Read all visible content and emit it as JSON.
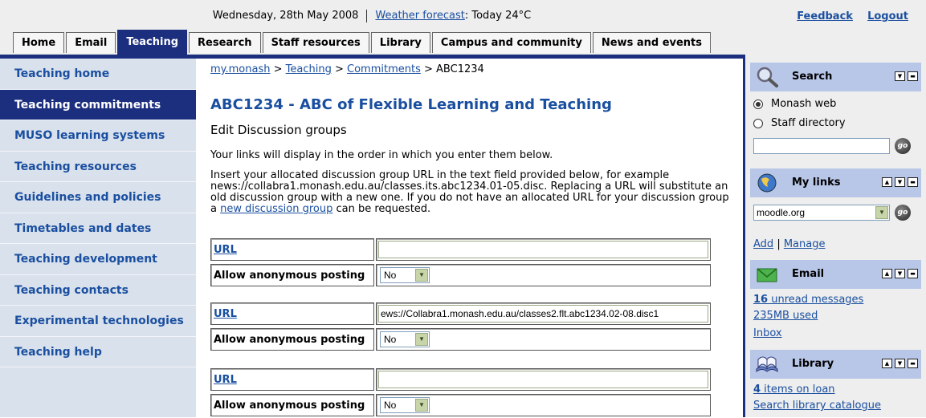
{
  "header": {
    "date": "Wednesday, 28th May 2008",
    "weather_link": "Weather forecast",
    "weather_text": ": Today 24°C",
    "feedback": "Feedback",
    "logout": "Logout"
  },
  "tabs": [
    {
      "label": "Home"
    },
    {
      "label": "Email"
    },
    {
      "label": "Teaching",
      "active": true
    },
    {
      "label": "Research"
    },
    {
      "label": "Staff resources"
    },
    {
      "label": "Library"
    },
    {
      "label": "Campus and community"
    },
    {
      "label": "News and events"
    }
  ],
  "nav": {
    "items": [
      {
        "label": "Teaching home"
      },
      {
        "label": "Teaching commitments",
        "active": true
      },
      {
        "label": "MUSO learning systems"
      },
      {
        "label": "Teaching resources"
      },
      {
        "label": "Guidelines and policies"
      },
      {
        "label": "Timetables and dates"
      },
      {
        "label": "Teaching development"
      },
      {
        "label": "Teaching contacts"
      },
      {
        "label": "Experimental technologies"
      },
      {
        "label": "Teaching help"
      }
    ]
  },
  "breadcrumb": {
    "crumb1": "my.monash",
    "sep": " > ",
    "crumb2": "Teaching",
    "crumb3": "Commitments",
    "current": "ABC1234"
  },
  "main": {
    "title": "ABC1234 - ABC of Flexible Learning and Teaching",
    "subtitle": "Edit Discussion groups",
    "intro": "Your links will display in the order in which you enter them below.",
    "instructions_before": "Insert your allocated discussion group URL in the text field provided below, for example news://collabra1.monash.edu.au/classes.its.abc1234.01-05.disc. Replacing a URL will substitute an old discussion group with a new one. If you do not have an allocated URL for your discussion group a ",
    "instructions_link": "new discussion group",
    "instructions_after": " can be requested.",
    "url_label": "URL",
    "anon_label": "Allow anonymous posting",
    "groups": [
      {
        "url": "",
        "anon": "No"
      },
      {
        "url": "ews://Collabra1.monash.edu.au/classes2.flt.abc1234.02-08.disc1",
        "anon": "No"
      },
      {
        "url": "",
        "anon": "No"
      }
    ]
  },
  "right": {
    "search": {
      "title": "Search",
      "option1": "Monash web",
      "option2": "Staff directory",
      "go": "go"
    },
    "mylinks": {
      "title": "My links",
      "selected": "moodle.org",
      "add": "Add",
      "divider": "|",
      "manage": "Manage"
    },
    "email": {
      "title": "Email",
      "unread_count": "16",
      "unread_text": " unread messages",
      "used": "235MB used",
      "inbox": "Inbox"
    },
    "library": {
      "title": "Library",
      "loan_count": "4",
      "loan_text": " items on loan",
      "search_catalogue": "Search library catalogue"
    }
  }
}
